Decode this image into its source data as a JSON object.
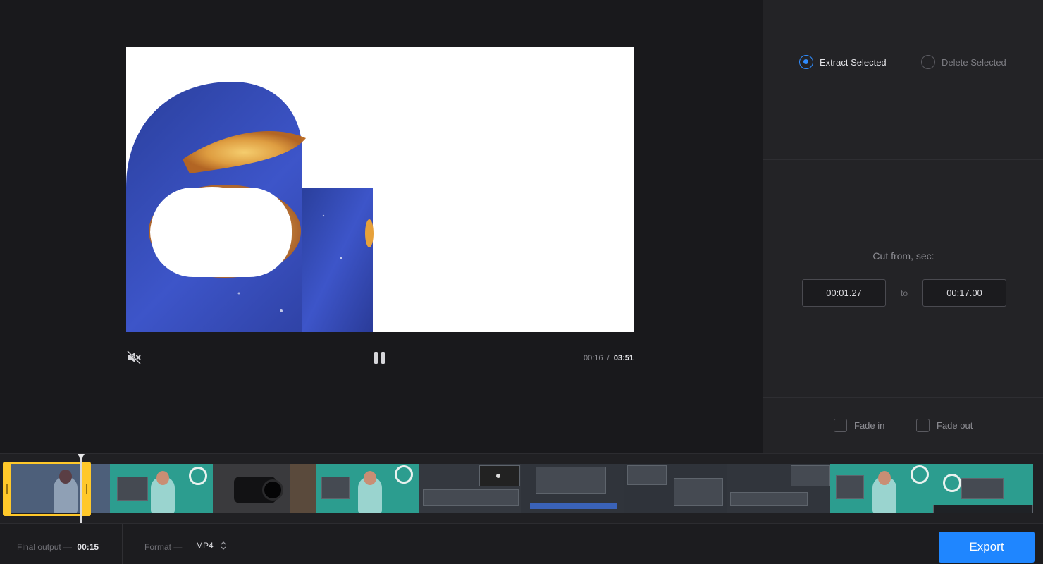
{
  "player": {
    "current_time": "00:16",
    "separator": "/",
    "total_time": "03:51",
    "muted": true
  },
  "side_panel": {
    "mode_options": [
      {
        "label": "Extract Selected",
        "selected": true
      },
      {
        "label": "Delete Selected",
        "selected": false
      }
    ],
    "cut_label": "Cut from, sec:",
    "cut_start": "00:01.27",
    "cut_to": "to",
    "cut_end": "00:17.00",
    "fade_in": {
      "label": "Fade in",
      "checked": false
    },
    "fade_out": {
      "label": "Fade out",
      "checked": false
    }
  },
  "footer": {
    "final_output_label": "Final output —",
    "final_output_value": "00:15",
    "format_label": "Format —",
    "format_value": "MP4",
    "export_label": "Export"
  },
  "colors": {
    "accent": "#1f86ff",
    "selection": "#ffc82a",
    "background": "#19191c",
    "panel": "#232326"
  }
}
